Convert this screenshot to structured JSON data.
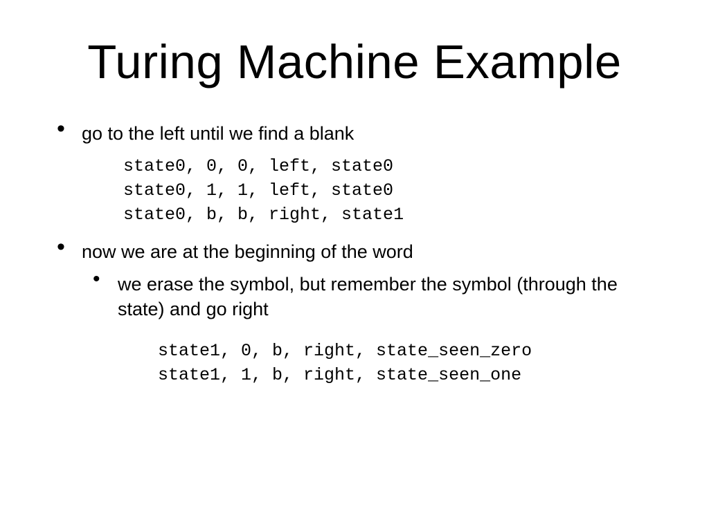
{
  "title": "Turing Machine Example",
  "bullets": [
    {
      "text": "go to the left until we find a blank",
      "code": "state0, 0, 0, left, state0\nstate0, 1, 1, left, state0\nstate0, b, b, right, state1"
    },
    {
      "text": "now we are at the beginning of the word",
      "sub": [
        {
          "text": "we erase the symbol, but remember the symbol (through the state) and go right",
          "code": "state1, 0, b, right, state_seen_zero\nstate1, 1, b, right, state_seen_one"
        }
      ]
    }
  ]
}
